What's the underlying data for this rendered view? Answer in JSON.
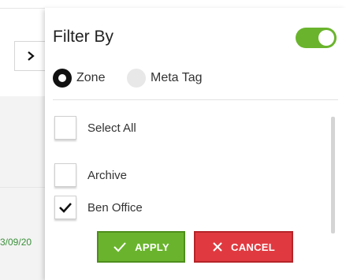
{
  "background": {
    "date_fragment": "3/09/20"
  },
  "filter": {
    "title": "Filter By",
    "toggle_on": true,
    "mode_options": [
      {
        "label": "Zone",
        "selected": true
      },
      {
        "label": "Meta Tag",
        "selected": false
      }
    ],
    "items": [
      {
        "label": "Select All",
        "checked": false
      },
      {
        "label": "Archive",
        "checked": false
      },
      {
        "label": "Ben Office",
        "checked": true
      }
    ],
    "apply_label": "APPLY",
    "cancel_label": "CANCEL"
  },
  "colors": {
    "accent_green": "#6ab42d",
    "cancel_red": "#e03a40"
  },
  "icons": [
    "chevron-right-icon",
    "checkmark-icon",
    "close-icon"
  ]
}
